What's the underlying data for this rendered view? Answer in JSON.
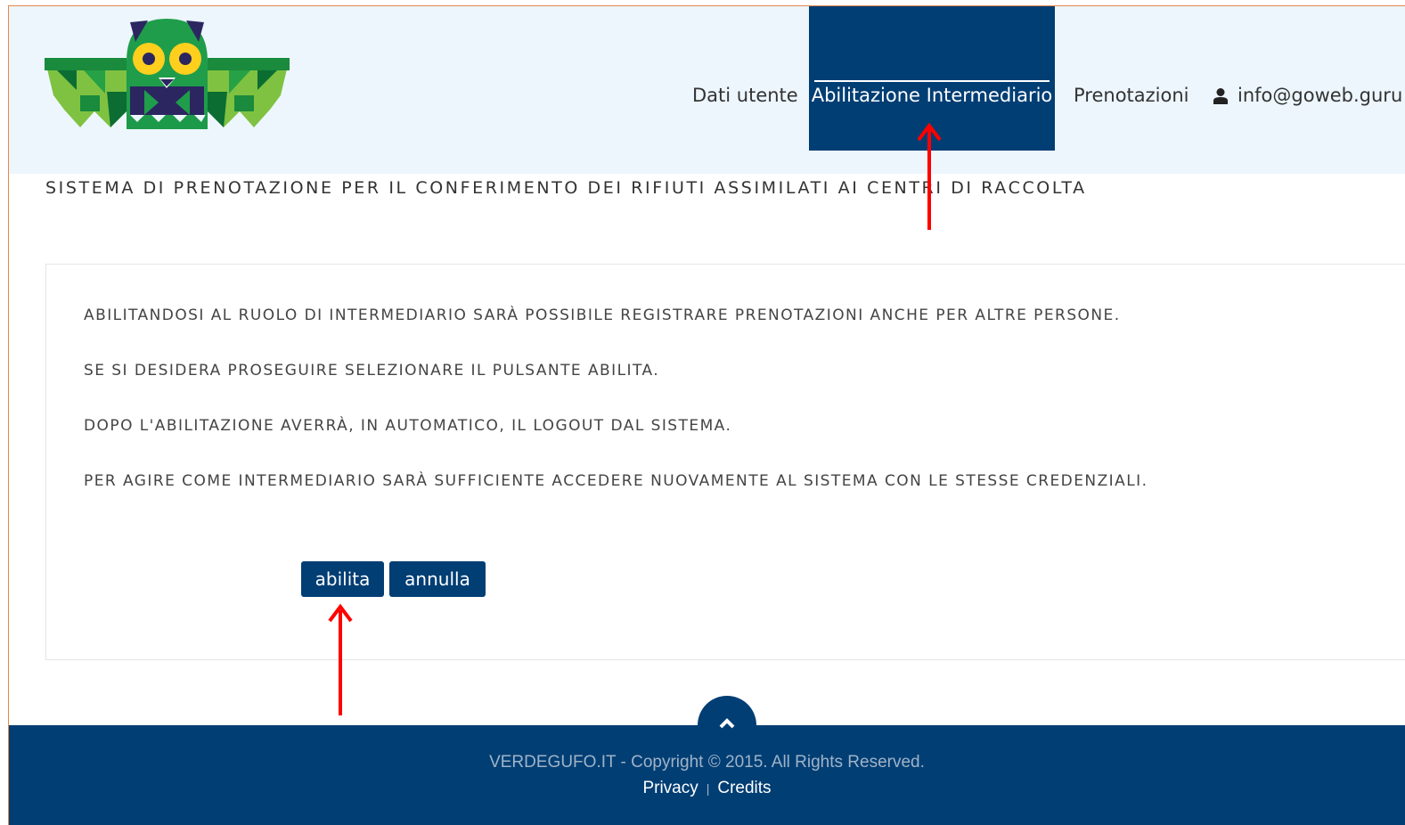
{
  "nav": {
    "items": [
      {
        "label": "Dati utente"
      },
      {
        "label": "Abilitazione Intermediario",
        "active": true
      },
      {
        "label": "Prenotazioni"
      }
    ],
    "user_email": "info@goweb.guru"
  },
  "page_title": "SISTEMA DI PRENOTAZIONE PER IL CONFERIMENTO DEI RIFIUTI ASSIMILATI AI CENTRI DI RACCOLTA",
  "panel": {
    "lines": [
      "ABILITANDOSI AL RUOLO DI INTERMEDIARIO SARÀ POSSIBILE REGISTRARE PRENOTAZIONI ANCHE PER ALTRE PERSONE.",
      "SE SI DESIDERA PROSEGUIRE SELEZIONARE IL PULSANTE ABILITA.",
      "DOPO L'ABILITAZIONE AVERRÀ, IN AUTOMATICO, IL LOGOUT DAL SISTEMA.",
      "PER AGIRE COME INTERMEDIARIO SARÀ SUFFICIENTE ACCEDERE NUOVAMENTE AL SISTEMA CON LE STESSE CREDENZIALI."
    ],
    "buttons": {
      "enable": "abilita",
      "cancel": "annulla"
    }
  },
  "footer": {
    "copyright": "VERDEGUFO.IT - Copyright © 2015. All Rights Reserved.",
    "privacy": "Privacy",
    "separator": "|",
    "credits": "Credits"
  },
  "colors": {
    "primary": "#013e74",
    "header_bg": "#edf6fd",
    "annotation": "#ff0000",
    "frame_border": "#e3894a"
  },
  "icons": [
    "owl-logo",
    "user-icon",
    "chevron-up-icon",
    "annotation-arrow"
  ]
}
